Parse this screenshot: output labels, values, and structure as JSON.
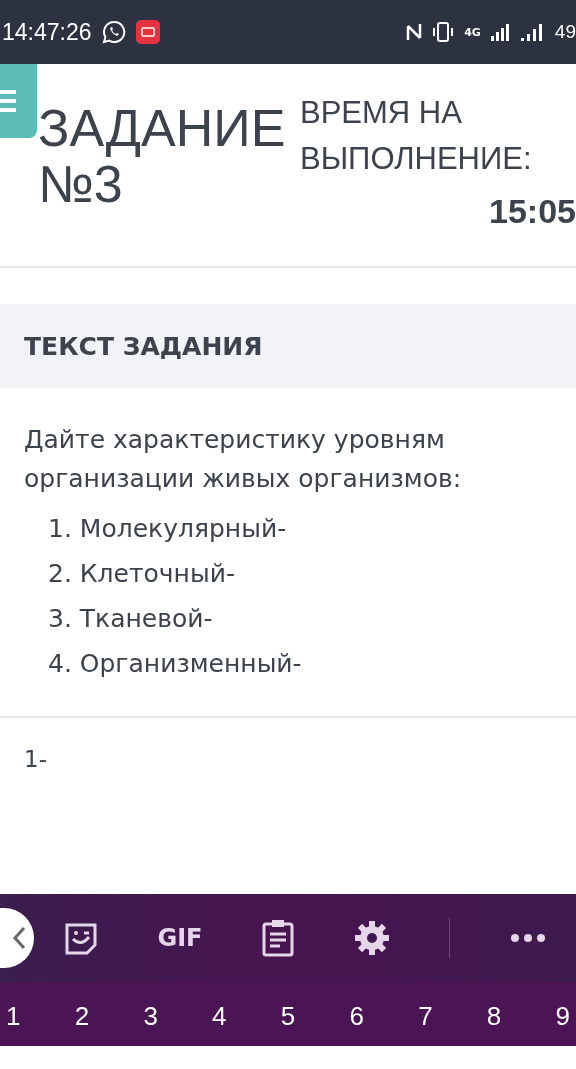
{
  "status_bar": {
    "time": "14:47:26",
    "network": "4G",
    "battery": "49"
  },
  "header": {
    "title": "ЗАДАНИЕ №3",
    "time_label": "ВРЕМЯ НА ВЫПОЛНЕНИЕ:",
    "timer": "15:05"
  },
  "task": {
    "heading": "ТЕКСТ ЗАДАНИЯ",
    "text": "Дайте характеристику уровням организации живых организмов:",
    "items": [
      {
        "number": "1.",
        "text": "Молекулярный-"
      },
      {
        "number": "2.",
        "text": "Клеточный-"
      },
      {
        "number": "3.",
        "text": "Тканевой-"
      },
      {
        "number": "4.",
        "text": "Организменный-"
      }
    ]
  },
  "answer": {
    "value": "1-"
  },
  "keyboard": {
    "toolbar": [
      {
        "kind": "sticker"
      },
      {
        "kind": "gif",
        "label": "GIF"
      },
      {
        "kind": "clipboard"
      },
      {
        "kind": "settings"
      },
      {
        "kind": "more"
      }
    ],
    "keys": [
      "1",
      "2",
      "3",
      "4",
      "5",
      "6",
      "7",
      "8",
      "9"
    ]
  }
}
